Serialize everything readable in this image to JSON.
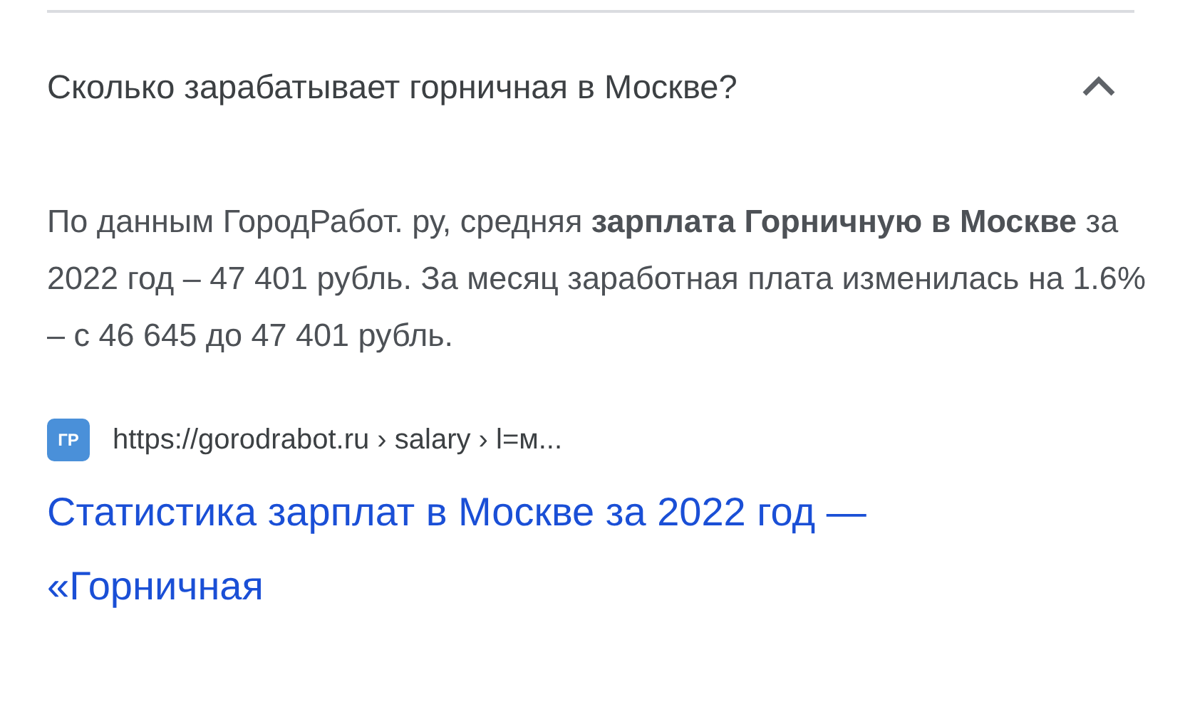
{
  "faq": {
    "question": "Сколько зарабатывает горничная в Москве?",
    "expanded": true,
    "answer": "По данным ГородРабот. ру, средняя **зарплата Горничную в Москве** за 2022 год – 47 401 рубль. За месяц заработная плата изменилась на 1.6% – с 46 645 до 47 401 рубль.",
    "source": {
      "favicon": "ГР",
      "url": "https://gorodrabot.ru › salary › l=м...",
      "title": "Статистика зарплат в Москве за 2022 год — «Горничная"
    }
  }
}
